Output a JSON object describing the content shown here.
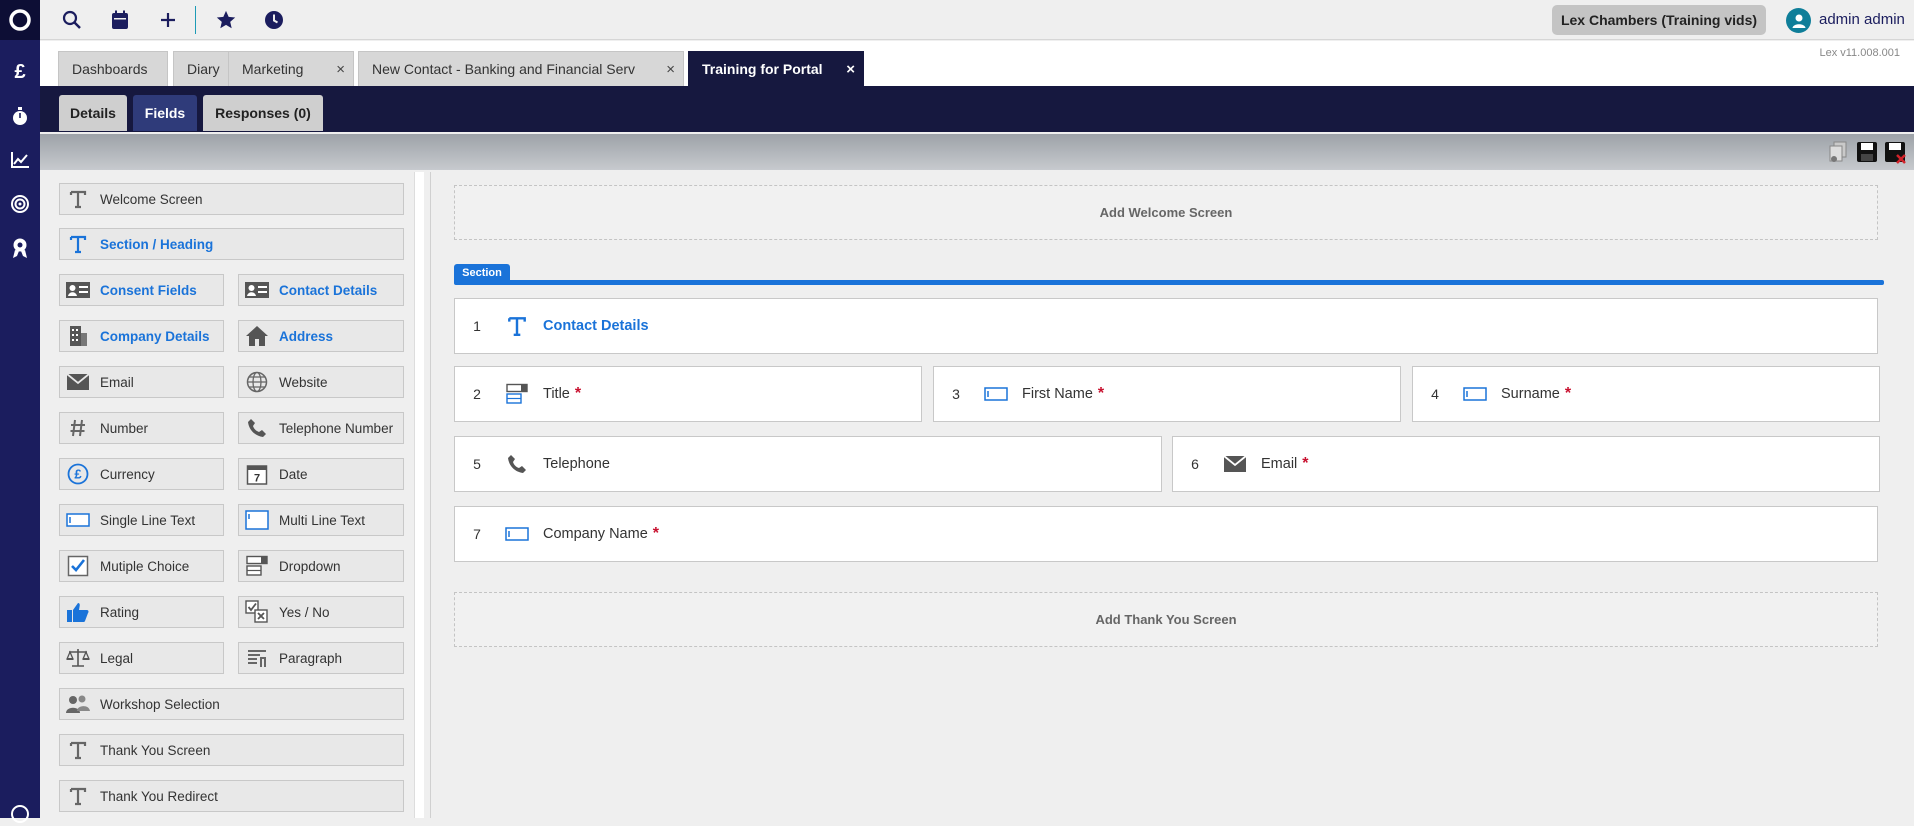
{
  "header": {
    "user_chip": "Lex Chambers (Training vids)",
    "user_name": "admin admin",
    "version": "Lex v11.008.001"
  },
  "rail": {
    "items": [
      "logo-icon",
      "pound-icon",
      "stopwatch-icon",
      "chart-icon",
      "target-icon",
      "award-icon",
      "help-icon"
    ],
    "pound_symbol": "£"
  },
  "tabs": [
    {
      "label": "Dashboards"
    },
    {
      "label": "Diary"
    },
    {
      "label": "Marketing"
    },
    {
      "label": "New Contact - Banking and Financial Serv"
    },
    {
      "label": "Training for Portal"
    }
  ],
  "close_glyph": "×",
  "subtabs": [
    {
      "label": "Details"
    },
    {
      "label": "Fields"
    },
    {
      "label": "Responses (0)"
    }
  ],
  "palette": [
    {
      "label": "Welcome Screen"
    },
    {
      "label": "Section / Heading"
    },
    {
      "label": "Consent Fields"
    },
    {
      "label": "Contact Details"
    },
    {
      "label": "Company Details"
    },
    {
      "label": "Address"
    },
    {
      "label": "Email"
    },
    {
      "label": "Website"
    },
    {
      "label": "Number"
    },
    {
      "label": "Telephone Number"
    },
    {
      "label": "Currency"
    },
    {
      "label": "Date"
    },
    {
      "label": "Single Line Text"
    },
    {
      "label": "Multi Line Text"
    },
    {
      "label": "Mutiple Choice"
    },
    {
      "label": "Dropdown"
    },
    {
      "label": "Rating"
    },
    {
      "label": "Yes / No"
    },
    {
      "label": "Legal"
    },
    {
      "label": "Paragraph"
    },
    {
      "label": "Workshop Selection"
    },
    {
      "label": "Thank You Screen"
    },
    {
      "label": "Thank You Redirect"
    }
  ],
  "canvas": {
    "add_welcome": "Add Welcome Screen",
    "section_tag": "Section",
    "add_thankyou": "Add Thank You Screen",
    "required_mark": "*",
    "fields": [
      {
        "num": "1",
        "label": "Contact Details",
        "required": false
      },
      {
        "num": "2",
        "label": "Title",
        "required": true
      },
      {
        "num": "3",
        "label": "First Name",
        "required": true
      },
      {
        "num": "4",
        "label": "Surname",
        "required": true
      },
      {
        "num": "5",
        "label": "Telephone",
        "required": false
      },
      {
        "num": "6",
        "label": "Email",
        "required": true
      },
      {
        "num": "7",
        "label": "Company Name",
        "required": true
      }
    ]
  },
  "colors": {
    "navy": "#1b1d5e",
    "accent_blue": "#1a73d9",
    "required_red": "#c8102e"
  }
}
